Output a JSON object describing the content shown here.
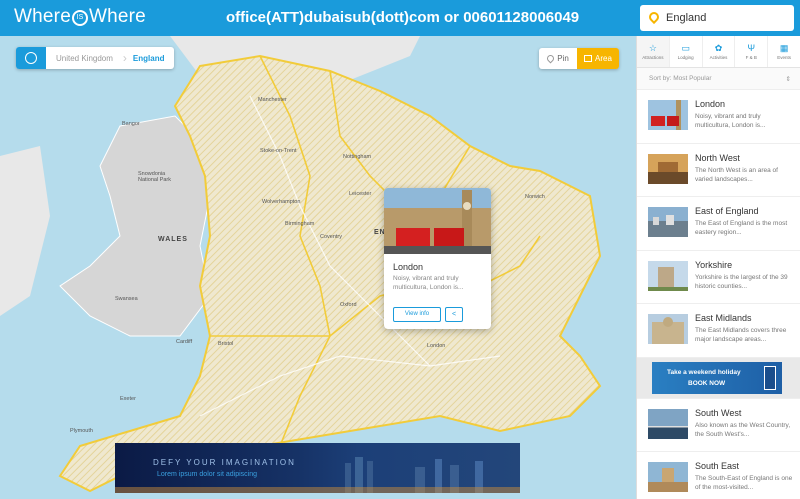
{
  "header": {
    "logo_left": "Where",
    "logo_mid": "IS",
    "logo_right": "Where",
    "contact": "office(ATT)dubaisub(dott)com or 00601128006049",
    "search_value": "England"
  },
  "breadcrumb": {
    "level1": "United Kingdom",
    "level2": "England"
  },
  "map_toggle": {
    "pin_label": "Pin",
    "area_label": "Area",
    "active": "Area"
  },
  "map_labels": {
    "wales": "WALES",
    "england_partial": "EN",
    "manchester": "Manchester",
    "bangor": "Bangor",
    "snowdonia": "Snowdonia National Park",
    "birmingham": "Birmingham",
    "nottingham": "Nottingham",
    "leicester": "Leicester",
    "stoke": "Stoke-on-Trent",
    "wolverhampton": "Wolverhampton",
    "coventry": "Coventry",
    "norwich": "Norwich",
    "oxford": "Oxford",
    "london": "London",
    "cardiff": "Cardiff",
    "bristol": "Bristol",
    "swansea": "Swansea",
    "plymouth": "Plymouth",
    "exeter": "Exeter"
  },
  "popup": {
    "title": "London",
    "description": "Noisy, vibrant and truly multicultura, London is...",
    "view_label": "View info",
    "share_icon": "share-icon"
  },
  "bottom_banner": {
    "headline": "DEFY YOUR IMAGINATION",
    "subline": "Lorem ipsum dolor sit adipiscing"
  },
  "sidebar": {
    "categories": [
      {
        "label": "Attractions",
        "icon": "star-icon"
      },
      {
        "label": "Lodging",
        "icon": "bed-icon"
      },
      {
        "label": "Activities",
        "icon": "activity-icon"
      },
      {
        "label": "F & B",
        "icon": "fork-knife-icon"
      },
      {
        "label": "Events",
        "icon": "events-icon"
      }
    ],
    "sort_label": "Sort by: Most Popular",
    "items": [
      {
        "title": "London",
        "description": "Noisy, vibrant and truly multicultura, London is..."
      },
      {
        "title": "North West",
        "description": "The North West is an area of varied landscapes..."
      },
      {
        "title": "East of England",
        "description": "The East of England is the most eastery region..."
      },
      {
        "title": "Yorkshire",
        "description": "Yorkshire is the largest of the 39 historic counties..."
      },
      {
        "title": "East Midlands",
        "description": "The East Midlands covers three major landscape areas..."
      },
      {
        "title": "South West",
        "description": "Also known as the West Country, the South West's..."
      },
      {
        "title": "South East",
        "description": "The South-East of England is one of the most-visited..."
      }
    ],
    "ad": {
      "line1": "Take a weekend holiday",
      "line2": "BOOK NOW"
    }
  },
  "colors": {
    "brand_blue": "#1a9bdb",
    "accent_yellow": "#f7b500",
    "sea": "#b5dcec"
  }
}
